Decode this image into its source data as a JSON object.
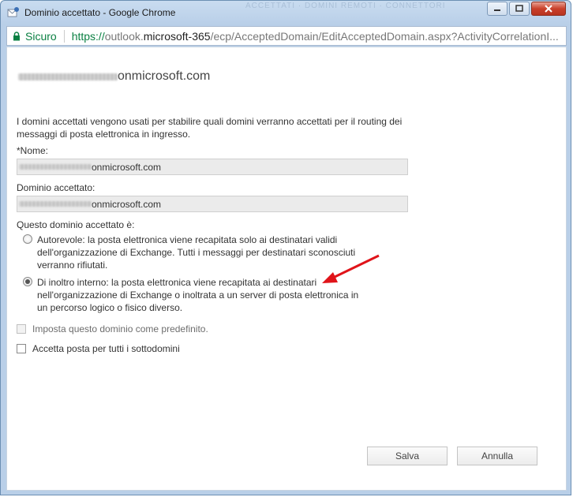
{
  "window": {
    "title": "Dominio accettato - Google Chrome",
    "background_tabs": "ACCETTATI · DOMINI REMOTI · CONNETTORI"
  },
  "address_bar": {
    "secure_label": "Sicuro",
    "url_proto": "https://",
    "url_host_a": "outlook.",
    "url_host_b": "microsoft-365",
    "url_path": "/ecp/AcceptedDomain/EditAcceptedDomain.aspx?ActivityCorrelationI..."
  },
  "page": {
    "heading_suffix": "onmicrosoft.com",
    "description": "I domini accettati vengono usati per stabilire quali domini verranno accettati per il routing dei messaggi di posta elettronica in ingresso.",
    "name_label": "*Nome:",
    "name_value_suffix": "onmicrosoft.com",
    "domain_label": "Dominio accettato:",
    "domain_value_suffix": "onmicrosoft.com",
    "type_label": "Questo dominio accettato è:",
    "radio_options": [
      {
        "label": "Autorevole: la posta elettronica viene recapitata solo ai destinatari validi dell'organizzazione di Exchange. Tutti i messaggi per destinatari sconosciuti verranno rifiutati.",
        "checked": false
      },
      {
        "label": "Di inoltro interno: la posta elettronica viene recapitata ai destinatari nell'organizzazione di Exchange o inoltrata a un server di posta elettronica in un percorso logico o fisico diverso.",
        "checked": true
      }
    ],
    "default_checkbox": {
      "label": "Imposta questo dominio come predefinito.",
      "checked": false,
      "disabled": true
    },
    "subdomain_checkbox": {
      "label": "Accetta posta per tutti i sottodomini",
      "checked": false,
      "disabled": false
    }
  },
  "buttons": {
    "save": "Salva",
    "cancel": "Annulla"
  },
  "colors": {
    "annotation_arrow": "#e0141a",
    "secure_green": "#0b8043"
  }
}
